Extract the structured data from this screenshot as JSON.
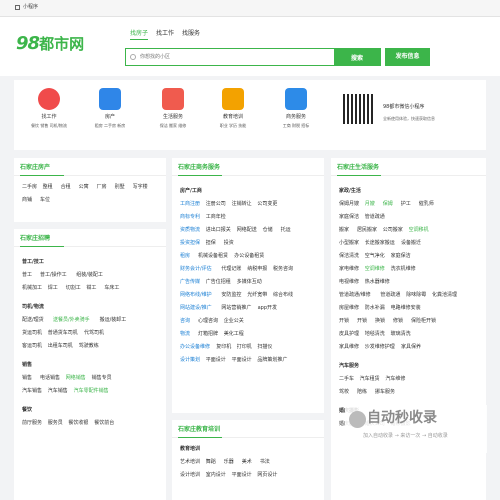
{
  "topbar": {
    "label": "小程序"
  },
  "header": {
    "logo_num": "98",
    "logo_text": "都市网",
    "tabs": [
      "找房子",
      "找工作",
      "找服务"
    ],
    "search_placeholder": "你想找的小区",
    "search_btn": "搜索",
    "post_btn": "发布信息"
  },
  "categories": [
    {
      "label": "找工作",
      "sub": "餐饮 销售 司机/物流",
      "color": "#f04b4b"
    },
    {
      "label": "房产",
      "sub": "租房 二手房 新房",
      "color": "#2f86e8"
    },
    {
      "label": "生活服务",
      "sub": "保洁 搬家 维修",
      "color": "#f05b4e"
    },
    {
      "label": "教育培训",
      "sub": "职业 学历 技能",
      "color": "#f3a200"
    },
    {
      "label": "商务服务",
      "sub": "工商 财税 招标",
      "color": "#2d8be8"
    }
  ],
  "qr": {
    "title": "98都市微信小程序",
    "sub": "全新使用体验，快速获取信息"
  },
  "panels": {
    "house": {
      "title": "石家庄房产",
      "rows": [
        [
          "二手房",
          "整租",
          "合租",
          "公寓",
          "厂房",
          "别墅",
          "写字楼"
        ],
        [
          "商铺",
          "车位"
        ]
      ]
    },
    "jobs": {
      "title": "石家庄招聘",
      "groups": [
        {
          "name": "普工/技工",
          "items": [
            [
              "普工",
              "普工/操作工",
              "组装/装配工"
            ],
            [
              "机械加工",
              "焊工",
              "切割工",
              "钳工",
              "车床工"
            ]
          ]
        },
        {
          "name": "司机/物流",
          "items": [
            [
              "配送/理货",
              "送餐员/外卖骑手",
              "搬运/装卸工"
            ],
            [
              "货运司机",
              "普通货车司机",
              "代驾司机"
            ],
            [
              "客运司机",
              "出租车司机",
              "驾驶教练"
            ]
          ]
        },
        {
          "name": "销售",
          "items": [
            [
              "销售",
              "电话销售",
              "网络销售",
              "销售专员"
            ],
            [
              "汽车销售",
              "汽车销售",
              "汽车零配件销售"
            ]
          ]
        },
        {
          "name": "餐饮",
          "items": [
            [
              "前厅服务",
              "服务员",
              "餐饮收银",
              "餐饮前台"
            ]
          ]
        }
      ]
    },
    "biz": {
      "title": "石家庄商务服务",
      "groups": [
        {
          "name": "房产/工商",
          "items": [
            [
              "工商注册",
              "注册公司",
              "注销转让",
              "公司变更"
            ],
            [
              "商标专利",
              "工商年检"
            ],
            [
              "资质物流",
              "进出口报关",
              "网络配送",
              "仓储",
              "托运"
            ],
            [
              "投资担保",
              "担保",
              "投资"
            ],
            [
              "租房",
              "机械设备租赁",
              "办公设备租赁"
            ],
            [
              "财务会计/评估",
              "代理记账",
              "纳税申报",
              "税务咨询"
            ],
            [
              "广告传媒",
              "广告位招租",
              "多媒体互动"
            ],
            [
              "网络布线/维护",
              "安防监控",
              "光纤宽带",
              "综合布线"
            ],
            [
              "网站建设/推广",
              "网站营销推广",
              "app开发"
            ],
            [
              "咨询",
              "心理咨询",
              "企业公关"
            ],
            [
              "物流",
              "灯箱招牌",
              "美化工程"
            ],
            [
              "办公设备维修",
              "复印机",
              "打印机",
              "扫描仪"
            ],
            [
              "设计策划",
              "平面设计",
              "平面设计",
              "品牌策划推广"
            ]
          ]
        }
      ]
    },
    "edu": {
      "title": "石家庄教育培训",
      "groups": [
        {
          "name": "教育培训",
          "items": [
            [
              "艺术培训",
              "舞蹈",
              "乐器",
              "美术",
              "书法"
            ],
            [
              "设计培训",
              "室内设计",
              "平面设计",
              "网页设计"
            ]
          ]
        }
      ]
    },
    "life": {
      "title": "石家庄生活服务",
      "groups": [
        {
          "name": "家政/生活",
          "items": [
            [
              "保姆月嫂",
              "月嫂",
              "保姆",
              "护工",
              "催乳师"
            ],
            [
              "家庭保洁",
              "管道疏通"
            ],
            [
              "搬家",
              "居民搬家",
              "公司搬家",
              "空调移机"
            ],
            [
              "小型搬家",
              "长途搬家搬运",
              "设备搬迁"
            ],
            [
              "保洁清洗",
              "空气净化",
              "家庭保洁"
            ],
            [
              "家电维修",
              "空调维修",
              "洗衣机维修"
            ],
            [
              "电视维修",
              "热水器维修"
            ],
            [
              "管道疏通/维修",
              "管道疏通",
              "除味除霉",
              "化粪池清理"
            ],
            [
              "房屋维修",
              "防水补漏",
              "电路维修安装"
            ],
            [
              "开锁",
              "开锁",
              "换锁",
              "修锁",
              "保险柜开锁"
            ],
            [
              "皮具护理",
              "地毯清洗",
              "玻璃清洗"
            ],
            [
              "家具维修",
              "沙发维修护理",
              "家具保养"
            ]
          ]
        },
        {
          "name": "汽车服务",
          "items": [
            [
              "二手车",
              "汽车租赁",
              "汽车维修"
            ],
            [
              "驾校",
              "陪练",
              "挪车服务"
            ]
          ]
        },
        {
          "name": "婚庆摄影",
          "items": [
            [
              "婚庆服务",
              "婚庆公司",
              "婚纱摄影"
            ]
          ]
        }
      ]
    }
  },
  "watermark": {
    "big": "自动秒收录",
    "small": "加入自动收录 → 来访一次 → 自动收录"
  }
}
